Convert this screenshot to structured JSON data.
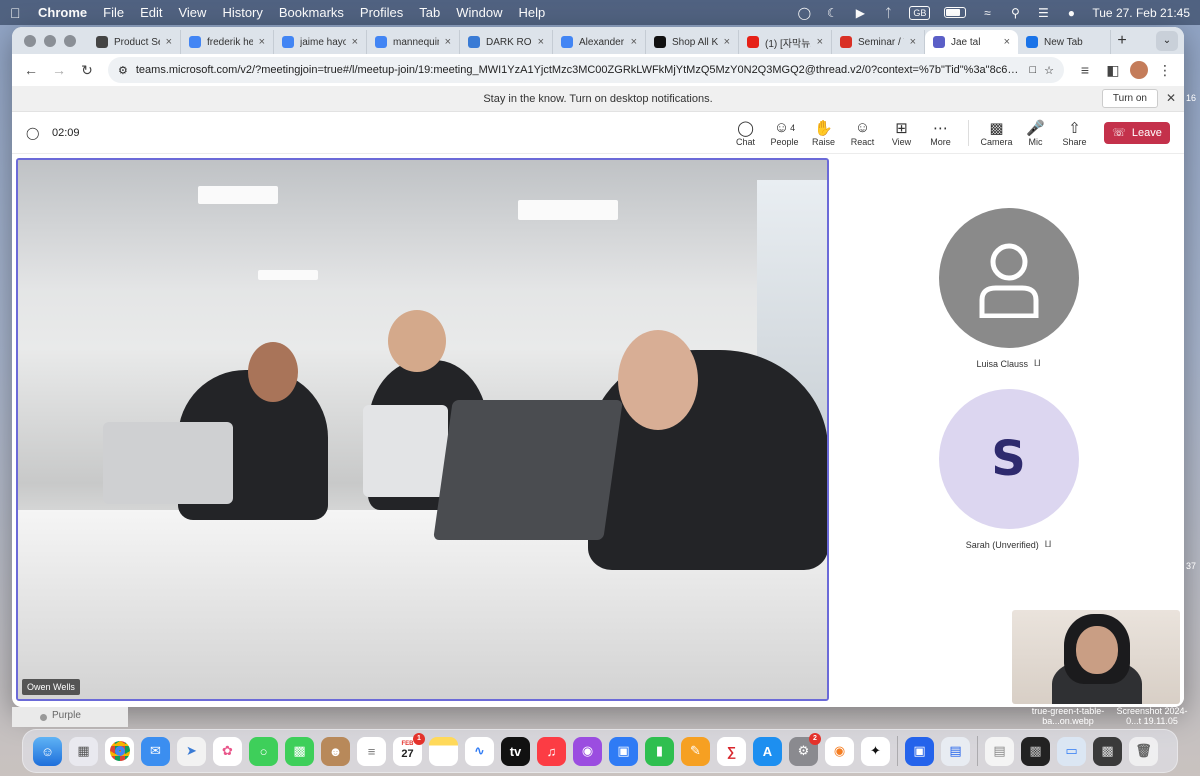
{
  "menubar": {
    "app_name": "Chrome",
    "items": [
      "File",
      "Edit",
      "View",
      "History",
      "Bookmarks",
      "Profiles",
      "Tab",
      "Window",
      "Help"
    ],
    "input_source": "GB",
    "datetime": "Tue 27. Feb  21:45"
  },
  "browser": {
    "tabs": [
      {
        "label": "Product Se",
        "favicon": "product-icon",
        "color": "#444"
      },
      {
        "label": "frederik he",
        "favicon": "google-icon",
        "color": "#4285f4"
      },
      {
        "label": "jaime hayo",
        "favicon": "google-icon",
        "color": "#4285f4"
      },
      {
        "label": "mannequin",
        "favicon": "google-icon",
        "color": "#4285f4"
      },
      {
        "label": "DARK ROO",
        "favicon": "3d-icon",
        "color": "#3a7bd5"
      },
      {
        "label": "Alexander",
        "favicon": "google-icon",
        "color": "#4285f4"
      },
      {
        "label": "Shop All K",
        "favicon": "k-icon",
        "color": "#111"
      },
      {
        "label": "(1) [자막뉴스",
        "favicon": "youtube-icon",
        "color": "#e62117"
      },
      {
        "label": "Seminar / V",
        "favicon": "gmail-icon",
        "color": "#d93025"
      },
      {
        "label": "Jae tal",
        "favicon": "teams-icon",
        "color": "#5b5fc7"
      },
      {
        "label": "New Tab",
        "favicon": "chrome-icon",
        "color": "#1a73e8"
      }
    ],
    "url": "teams.microsoft.com/v2/?meetingjoin=true#/l/meetup-join/19:meeting_MWI1YzA1YjctMzc3MC00ZGRkLWFkMjYtMzQ5MzY0N2Q3MGQ2@thread.v2/0?context=%7b\"Tid\"%3a\"8c6429c4-167f-477..."
  },
  "notification": {
    "text": "Stay in the know. Turn on desktop notifications.",
    "button": "Turn on"
  },
  "meeting": {
    "timer": "02:09",
    "controls": [
      {
        "label": "Chat",
        "icon": "chat-icon"
      },
      {
        "label": "People",
        "icon": "people-icon",
        "count": "4"
      },
      {
        "label": "Raise",
        "icon": "raise-hand-icon"
      },
      {
        "label": "React",
        "icon": "react-icon"
      },
      {
        "label": "View",
        "icon": "view-icon"
      },
      {
        "label": "More",
        "icon": "more-icon"
      }
    ],
    "media_controls": [
      {
        "label": "Camera",
        "icon": "camera-icon"
      },
      {
        "label": "Mic",
        "icon": "mic-icon"
      },
      {
        "label": "Share",
        "icon": "share-icon"
      }
    ],
    "leave_label": "Leave",
    "leave_color": "#c4314b",
    "main_speaker": "Owen Wells",
    "participants": [
      {
        "name": "Luisa Clauss",
        "avatar": "person-silhouette-icon",
        "initial": "",
        "muted": true
      },
      {
        "name": "Sarah (Unverified)",
        "avatar": "initial",
        "initial": "S",
        "muted": true
      }
    ]
  },
  "desktop": {
    "finder_label": "Purple",
    "files": [
      {
        "name": "true-green-t-table-ba...on.webp"
      },
      {
        "name": "Screenshot 2024-0...t 19.11.05"
      }
    ],
    "edge_numbers": [
      "16",
      "37"
    ]
  },
  "dock": {
    "calendar_month": "FEB",
    "calendar_day": "27",
    "calendar_badge": "1",
    "settings_badge": "2"
  }
}
